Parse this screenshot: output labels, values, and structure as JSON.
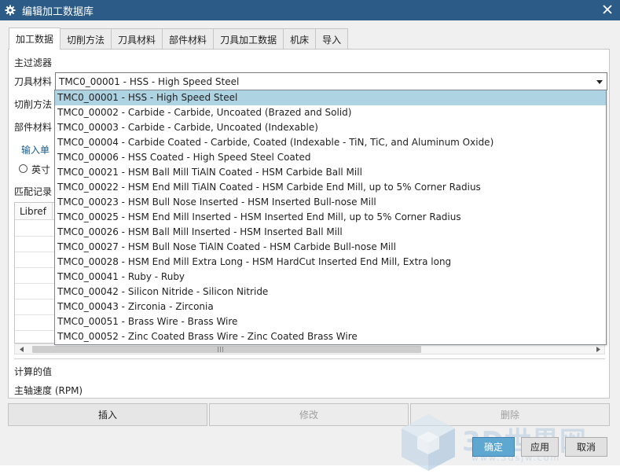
{
  "window": {
    "title": "编辑加工数据库",
    "close_glyph": "✕"
  },
  "tabs": [
    {
      "label": "加工数据",
      "active": true
    },
    {
      "label": "切削方法"
    },
    {
      "label": "刀具材料"
    },
    {
      "label": "部件材料"
    },
    {
      "label": "刀具加工数据"
    },
    {
      "label": "机床"
    },
    {
      "label": "导入"
    }
  ],
  "filter": {
    "heading": "主过滤器",
    "tool_material_label": "刀具材料",
    "tool_material_value": "TMC0_00001 - HSS - High Speed Steel",
    "cut_method_label": "切削方法",
    "part_material_label": "部件材料",
    "units_label": "输入单",
    "radio_inch_label": "英寸"
  },
  "records": {
    "heading": "匹配记录",
    "col_libref": "Libref"
  },
  "computed": {
    "heading": "计算的值",
    "spindle_speed_label": "主轴速度 (RPM)"
  },
  "dropdown_options": [
    "TMC0_00001 - HSS - High Speed Steel",
    "TMC0_00002 - Carbide - Carbide, Uncoated (Brazed and Solid)",
    "TMC0_00003 - Carbide - Carbide, Uncoated (Indexable)",
    "TMC0_00004 - Carbide Coated - Carbide, Coated (Indexable - TiN, TiC, and Aluminum Oxide)",
    "TMC0_00006 - HSS Coated - High Speed Steel Coated",
    "TMC0_00021 - HSM Ball Mill TiAlN Coated - HSM Carbide Ball Mill",
    "TMC0_00022 - HSM End Mill TiAlN Coated - HSM Carbide End Mill, up to 5% Corner Radius",
    "TMC0_00023 - HSM Bull Nose Inserted - HSM Inserted Bull-nose Mill",
    "TMC0_00025 - HSM End Mill Inserted - HSM Inserted End Mill, up to 5% Corner Radius",
    "TMC0_00026 - HSM Ball Mill Inserted - HSM Inserted Ball Mill",
    "TMC0_00027 - HSM Bull Nose TiAlN Coated - HSM Carbide Bull-nose Mill",
    "TMC0_00028 - HSM End Mill Extra Long - HSM HardCut Inserted End Mill, Extra long",
    "TMC0_00041 - Ruby - Ruby",
    "TMC0_00042 - Silicon Nitride - Silicon Nitride",
    "TMC0_00043 - Zirconia - Zirconia",
    "TMC0_00051 - Brass Wire - Brass Wire",
    "TMC0_00052 - Zinc Coated Brass Wire - Zinc Coated Brass Wire"
  ],
  "actions": {
    "insert": "插入",
    "modify": "修改",
    "delete": "删除"
  },
  "footer": {
    "ok": "确定",
    "apply": "应用",
    "cancel": "取消"
  },
  "watermark": {
    "text": "3D世界网",
    "url": "www.3dsjw.com"
  },
  "colors": {
    "titlebar": "#2b5b86",
    "selection": "#aed3e2",
    "primary_button": "#5ea7d0"
  }
}
